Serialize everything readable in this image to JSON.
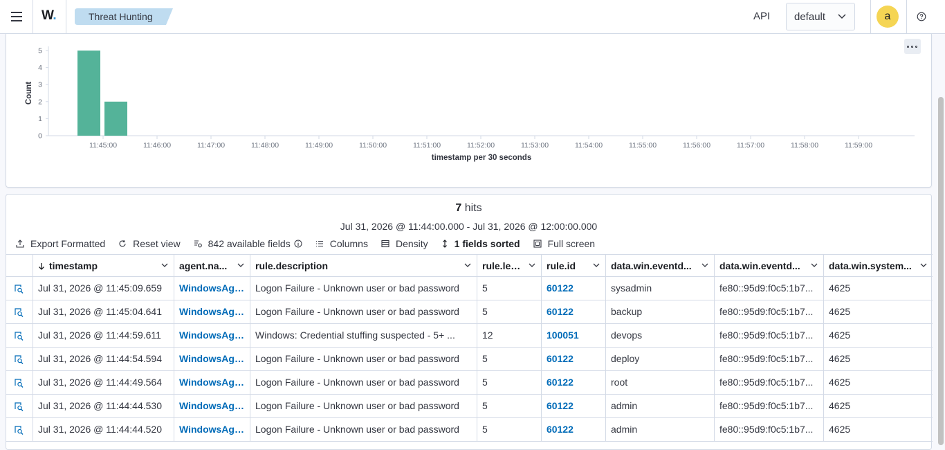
{
  "header": {
    "logo_text": "W",
    "logo_dot": ".",
    "breadcrumb": "Threat Hunting",
    "api_label": "API",
    "tenant_value": "default",
    "avatar_initial": "a"
  },
  "colors": {
    "bar": "#54b399",
    "link": "#006bb8",
    "avatar": "#f5d554",
    "breadcrumb_bg": "#bfdcf0"
  },
  "chart_data": {
    "type": "bar",
    "ylabel": "Count",
    "xlabel": "timestamp per 30 seconds",
    "ylim": [
      0,
      5
    ],
    "y_ticks": [
      "0",
      "1",
      "2",
      "3",
      "4",
      "5"
    ],
    "x_ticks": [
      "11:45:00",
      "11:46:00",
      "11:47:00",
      "11:48:00",
      "11:49:00",
      "11:50:00",
      "11:51:00",
      "11:52:00",
      "11:53:00",
      "11:54:00",
      "11:55:00",
      "11:56:00",
      "11:57:00",
      "11:58:00",
      "11:59:00"
    ],
    "categories": [
      "11:44:30",
      "11:45:00"
    ],
    "values": [
      5,
      2
    ]
  },
  "results": {
    "hits_count": "7",
    "hits_label": "hits",
    "time_range": "Jul 31, 2026 @ 11:44:00.000 - Jul 31, 2026 @ 12:00:00.000"
  },
  "toolbar": {
    "export": "Export Formatted",
    "reset": "Reset view",
    "fields": "842 available fields",
    "columns": "Columns",
    "density": "Density",
    "sorted": "1 fields sorted",
    "fullscreen": "Full screen"
  },
  "table": {
    "columns": [
      "timestamp",
      "agent.na...",
      "rule.description",
      "rule.level",
      "rule.id",
      "data.win.eventd...",
      "data.win.eventd...",
      "data.win.system..."
    ],
    "rows": [
      [
        "Jul 31, 2026 @ 11:45:09.659",
        "WindowsAgen",
        "Logon Failure - Unknown user or bad password",
        "5",
        "60122",
        "sysadmin",
        "fe80::95d9:f0c5:1b7...",
        "4625"
      ],
      [
        "Jul 31, 2026 @ 11:45:04.641",
        "WindowsAgen",
        "Logon Failure - Unknown user or bad password",
        "5",
        "60122",
        "backup",
        "fe80::95d9:f0c5:1b7...",
        "4625"
      ],
      [
        "Jul 31, 2026 @ 11:44:59.611",
        "WindowsAgen",
        "Windows: Credential stuffing suspected - 5+ ...",
        "12",
        "100051",
        "devops",
        "fe80::95d9:f0c5:1b7...",
        "4625"
      ],
      [
        "Jul 31, 2026 @ 11:44:54.594",
        "WindowsAgen",
        "Logon Failure - Unknown user or bad password",
        "5",
        "60122",
        "deploy",
        "fe80::95d9:f0c5:1b7...",
        "4625"
      ],
      [
        "Jul 31, 2026 @ 11:44:49.564",
        "WindowsAgen",
        "Logon Failure - Unknown user or bad password",
        "5",
        "60122",
        "root",
        "fe80::95d9:f0c5:1b7...",
        "4625"
      ],
      [
        "Jul 31, 2026 @ 11:44:44.530",
        "WindowsAgen",
        "Logon Failure - Unknown user or bad password",
        "5",
        "60122",
        "admin",
        "fe80::95d9:f0c5:1b7...",
        "4625"
      ],
      [
        "Jul 31, 2026 @ 11:44:44.520",
        "WindowsAgen",
        "Logon Failure - Unknown user or bad password",
        "5",
        "60122",
        "admin",
        "fe80::95d9:f0c5:1b7...",
        "4625"
      ]
    ]
  }
}
